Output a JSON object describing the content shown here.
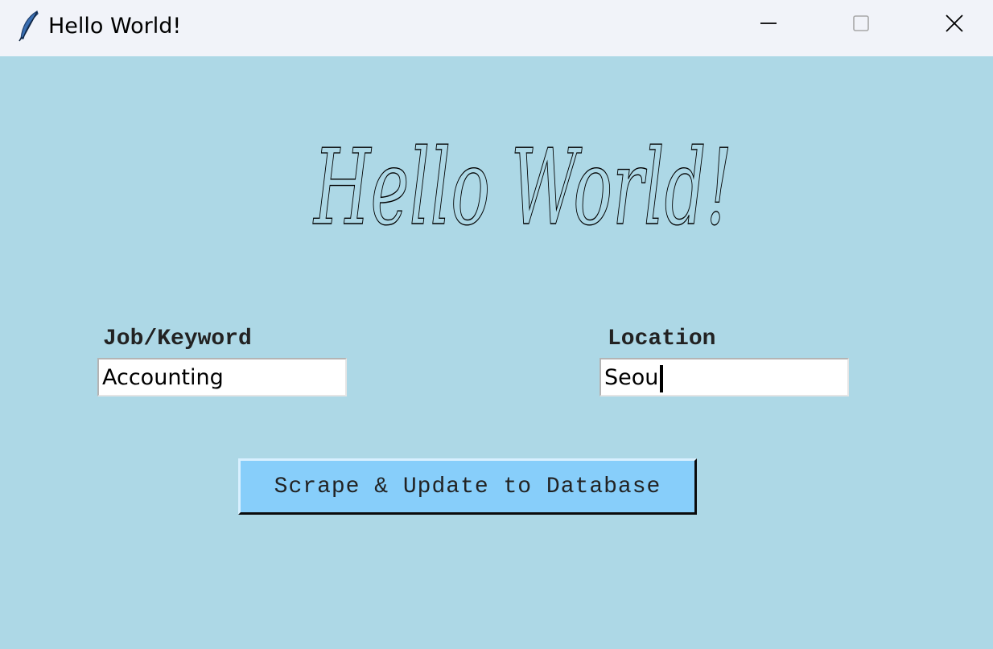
{
  "window": {
    "title": "Hello World!",
    "icon": "feather-icon",
    "controls": [
      "minimize-icon",
      "maximize-icon",
      "close-icon"
    ]
  },
  "heading": {
    "text": "Hello World!"
  },
  "form": {
    "job_label": "Job/Keyword",
    "job_value": "Accounting",
    "location_label": "Location",
    "location_value": "Seoul",
    "submit_label": "Scrape & Update to Database"
  },
  "colors": {
    "background": "#ADD8E6",
    "titlebar": "#F1F3F9",
    "button": "#87CEFA"
  }
}
